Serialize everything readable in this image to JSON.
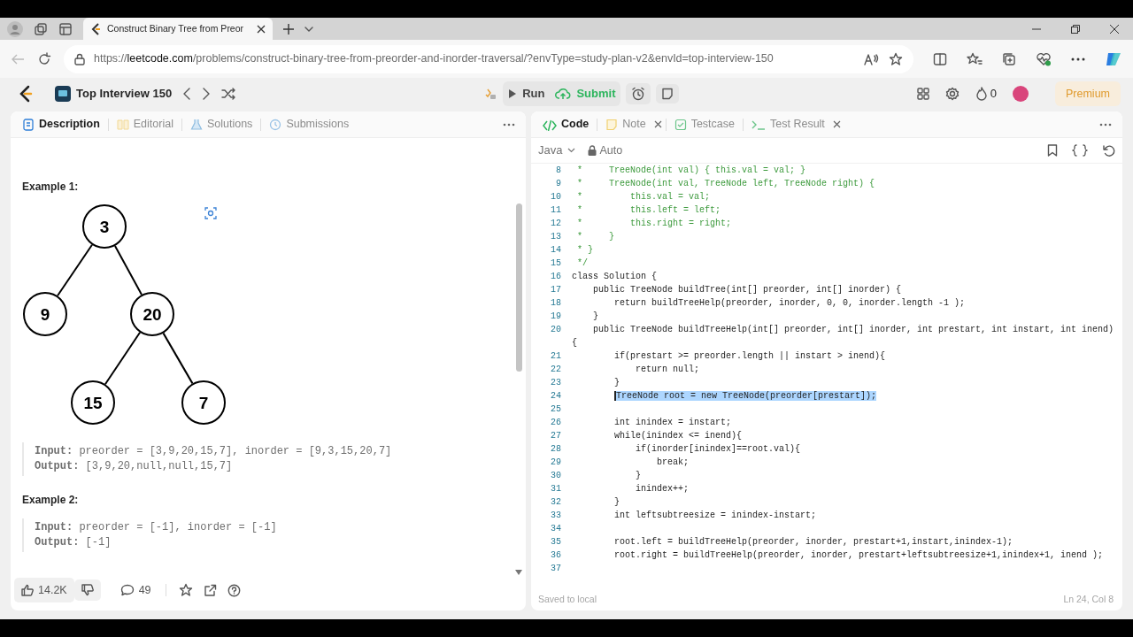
{
  "browser": {
    "tabs": [
      {
        "title": "Construct Binary Tree from Preor",
        "selected": true
      }
    ],
    "url": {
      "scheme": "https://",
      "host": "leetcode.com",
      "path": "/problems/construct-binary-tree-from-preorder-and-inorder-traversal/?envType=study-plan-v2&envId=top-interview-150"
    }
  },
  "navbar": {
    "study_plan": "Top Interview 150",
    "run": "Run",
    "submit": "Submit",
    "streak": "0",
    "premium": "Premium"
  },
  "left_panel": {
    "tabs": [
      {
        "label": "Description",
        "selected": true
      },
      {
        "label": "Editorial",
        "selected": false
      },
      {
        "label": "Solutions",
        "selected": false
      },
      {
        "label": "Submissions",
        "selected": false
      }
    ],
    "examples": [
      {
        "title": "Example 1:",
        "tree": {
          "value": "3",
          "children": [
            {
              "value": "9"
            },
            {
              "value": "20",
              "children": [
                {
                  "value": "15"
                },
                {
                  "value": "7"
                }
              ]
            }
          ]
        },
        "lines": [
          "**Input:** preorder = [3,9,20,15,7], inorder = [9,3,15,20,7]",
          "**Output:** [3,9,20,null,null,15,7]"
        ]
      },
      {
        "title": "Example 2:",
        "lines": [
          "**Input:** preorder = [-1], inorder = [-1]",
          "**Output:** [-1]"
        ]
      }
    ],
    "likes": "14.2K",
    "comments": "49"
  },
  "right_panel": {
    "tabs": [
      {
        "label": "Code",
        "selected": true,
        "closable": false
      },
      {
        "label": "Note",
        "selected": false,
        "closable": true
      },
      {
        "label": "Testcase",
        "selected": false,
        "closable": false
      },
      {
        "label": "Test Result",
        "selected": false,
        "closable": true
      }
    ],
    "language": "Java",
    "mode": "Auto",
    "code": [
      {
        "num": "8",
        "selected": false,
        "kind": "comment",
        "text": " *     TreeNode(int val) { this.val = val; }"
      },
      {
        "num": "9",
        "selected": false,
        "kind": "comment",
        "text": " *     TreeNode(int val, TreeNode left, TreeNode right) {"
      },
      {
        "num": "10",
        "selected": false,
        "kind": "comment",
        "text": " *         this.val = val;"
      },
      {
        "num": "11",
        "selected": false,
        "kind": "comment",
        "text": " *         this.left = left;"
      },
      {
        "num": "12",
        "selected": false,
        "kind": "comment",
        "text": " *         this.right = right;"
      },
      {
        "num": "13",
        "selected": false,
        "kind": "comment",
        "text": " *     }"
      },
      {
        "num": "14",
        "selected": false,
        "kind": "comment",
        "text": " * }"
      },
      {
        "num": "15",
        "selected": false,
        "kind": "comment",
        "text": " */"
      },
      {
        "num": "16",
        "selected": false,
        "kind": "code",
        "text": "class Solution {"
      },
      {
        "num": "17",
        "selected": false,
        "kind": "code",
        "text": "    public TreeNode buildTree(int[] preorder, int[] inorder) {"
      },
      {
        "num": "18",
        "selected": false,
        "kind": "code",
        "text": "        return buildTreeHelp(preorder, inorder, 0, 0, inorder.length -1 );"
      },
      {
        "num": "19",
        "selected": false,
        "kind": "code",
        "text": "    }"
      },
      {
        "num": "20",
        "selected": false,
        "kind": "code",
        "text": "    public TreeNode buildTreeHelp(int[] preorder, int[] inorder, int prestart, int instart, int inend)",
        "continuation": "{"
      },
      {
        "num": "21",
        "selected": false,
        "kind": "code",
        "text": "        if(prestart >= preorder.length || instart > inend){"
      },
      {
        "num": "22",
        "selected": false,
        "kind": "code",
        "text": "            return null;"
      },
      {
        "num": "23",
        "selected": false,
        "kind": "code",
        "text": "        }"
      },
      {
        "num": "24",
        "selected": true,
        "kind": "code",
        "text": "        TreeNode root = new TreeNode(preorder[prestart]);"
      },
      {
        "num": "25",
        "selected": false
      },
      {
        "num": "26",
        "selected": false,
        "kind": "code",
        "text": "        int inindex = instart;"
      },
      {
        "num": "27",
        "selected": false,
        "kind": "code",
        "text": "        while(inindex <= inend){"
      },
      {
        "num": "28",
        "selected": false,
        "kind": "code",
        "text": "            if(inorder[inindex]==root.val){"
      },
      {
        "num": "29",
        "selected": false,
        "kind": "code",
        "text": "                break;"
      },
      {
        "num": "30",
        "selected": false,
        "kind": "code",
        "text": "            }"
      },
      {
        "num": "31",
        "selected": false,
        "kind": "code",
        "text": "            inindex++;"
      },
      {
        "num": "32",
        "selected": false,
        "kind": "code",
        "text": "        }"
      },
      {
        "num": "33",
        "selected": false,
        "kind": "code",
        "text": "        int leftsubtreesize = inindex-instart;"
      },
      {
        "num": "34",
        "selected": false
      },
      {
        "num": "35",
        "selected": false,
        "kind": "code",
        "text": "        root.left = buildTreeHelp(preorder, inorder, prestart+1,instart,inindex-1);"
      },
      {
        "num": "36",
        "selected": false,
        "kind": "code",
        "text": "        root.right = buildTreeHelp(preorder, inorder, prestart+leftsubtreesize+1,inindex+1, inend );"
      },
      {
        "num": "37",
        "selected": false
      }
    ],
    "status": "Saved to local",
    "cursor": "Ln 24, Col 8"
  }
}
